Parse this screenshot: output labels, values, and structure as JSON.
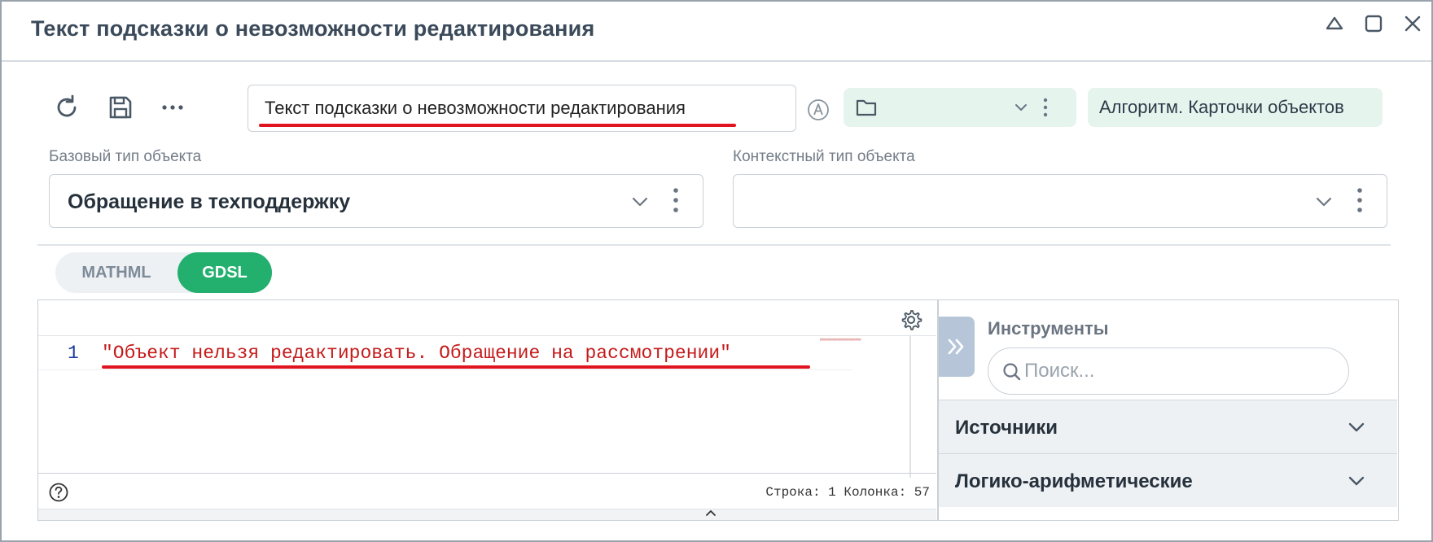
{
  "window": {
    "title": "Текст подсказки о невозможности редактирования"
  },
  "toolbar": {
    "name_value": "Текст подсказки о невозможности редактирования",
    "algorithm_chip": "Алгоритм. Карточки объектов"
  },
  "fields": {
    "base_type_label": "Базовый тип объекта",
    "base_type_value": "Обращение в техподдержку",
    "context_type_label": "Контекстный тип объекта",
    "context_type_value": ""
  },
  "modes": {
    "mathml": "MATHML",
    "gdsl": "GDSL",
    "active": "GDSL"
  },
  "editor": {
    "lines": [
      {
        "number": "1",
        "text": "\"Объект нельзя редактировать. Обращение на рассмотрении\""
      }
    ],
    "status": "Строка: 1 Колонка: 57"
  },
  "tools": {
    "title": "Инструменты",
    "search_placeholder": "Поиск...",
    "sections": [
      "Источники",
      "Логико-арифметические"
    ]
  },
  "colors": {
    "accent_green": "#23b06f",
    "chip_bg": "#e6f4ee",
    "highlight_red": "#e0141e",
    "code_string": "#c41a1a"
  }
}
